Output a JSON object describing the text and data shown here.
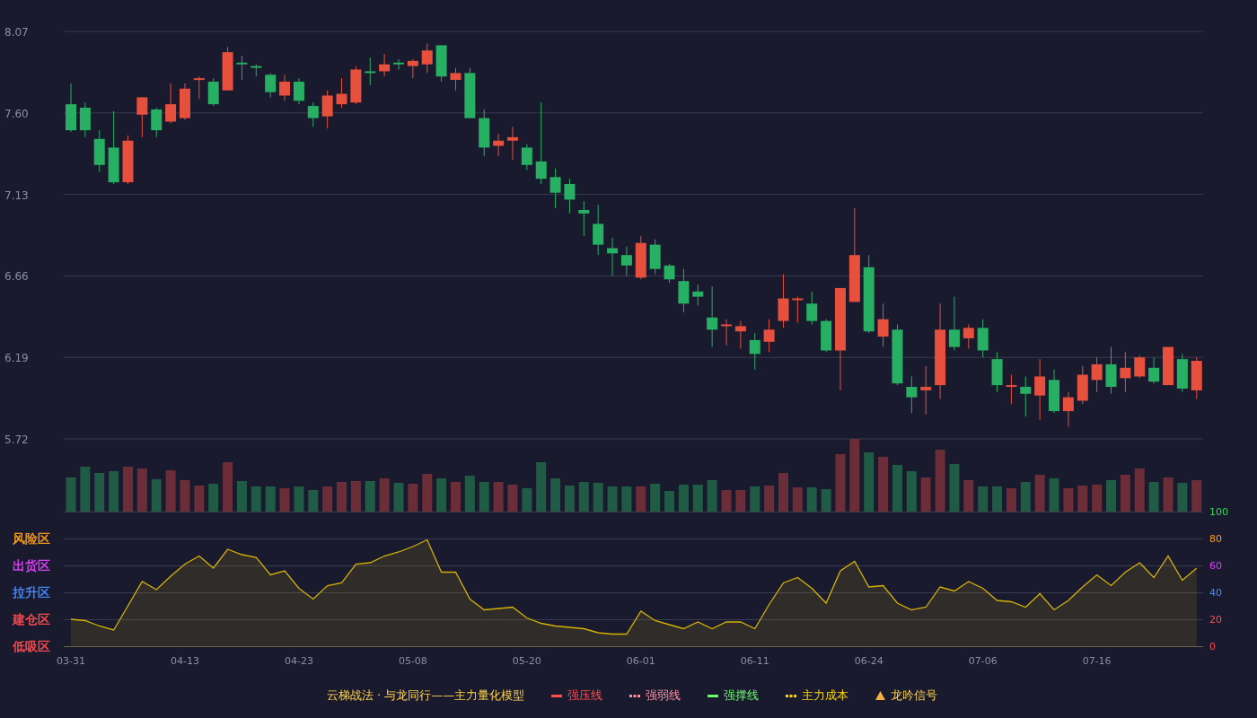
{
  "price_chart": {
    "chart_data": {
      "type": "candlestick",
      "grid": true,
      "ylim": [
        5.72,
        8.07
      ],
      "yticks": [
        {
          "value": 8.07,
          "label": "8.07"
        },
        {
          "value": 7.6,
          "label": "7.60"
        },
        {
          "value": 7.13,
          "label": "7.13"
        },
        {
          "value": 6.66,
          "label": "6.66"
        },
        {
          "value": 6.19,
          "label": "6.19"
        },
        {
          "value": 5.72,
          "label": "5.72"
        }
      ],
      "categories": [
        null,
        null,
        null,
        null,
        null,
        null,
        null,
        null,
        null,
        null,
        null,
        null,
        null,
        null,
        null,
        null,
        null,
        null,
        null,
        null,
        null,
        null,
        null,
        null,
        null,
        null,
        null,
        null,
        null,
        null,
        null,
        null,
        null,
        null,
        null,
        null,
        null,
        null,
        null,
        null,
        null,
        null,
        null,
        null,
        null,
        null,
        null,
        null,
        null,
        null,
        null,
        null,
        null,
        null,
        null,
        null,
        null,
        null,
        null,
        null,
        null,
        null,
        null,
        null,
        null,
        null,
        null,
        null,
        null,
        null,
        null,
        null,
        null,
        null,
        null,
        null,
        null,
        null,
        null,
        null
      ],
      "ohlc": [
        [
          7.65,
          7.77,
          7.49,
          7.5
        ],
        [
          7.63,
          7.66,
          7.46,
          7.5
        ],
        [
          7.45,
          7.5,
          7.26,
          7.3
        ],
        [
          7.4,
          7.61,
          7.19,
          7.2
        ],
        [
          7.2,
          7.47,
          7.19,
          7.44
        ],
        [
          7.59,
          7.69,
          7.46,
          7.69
        ],
        [
          7.62,
          7.63,
          7.46,
          7.5
        ],
        [
          7.55,
          7.77,
          7.54,
          7.65
        ],
        [
          7.57,
          7.77,
          7.56,
          7.74
        ],
        [
          7.79,
          7.81,
          7.68,
          7.8
        ],
        [
          7.78,
          7.8,
          7.64,
          7.65
        ],
        [
          7.73,
          7.98,
          7.73,
          7.95
        ],
        [
          7.89,
          7.93,
          7.79,
          7.88
        ],
        [
          7.87,
          7.88,
          7.81,
          7.86
        ],
        [
          7.82,
          7.83,
          7.69,
          7.72
        ],
        [
          7.7,
          7.82,
          7.67,
          7.78
        ],
        [
          7.78,
          7.8,
          7.65,
          7.67
        ],
        [
          7.64,
          7.66,
          7.52,
          7.57
        ],
        [
          7.58,
          7.73,
          7.51,
          7.7
        ],
        [
          7.65,
          7.8,
          7.63,
          7.71
        ],
        [
          7.66,
          7.87,
          7.65,
          7.85
        ],
        [
          7.84,
          7.92,
          7.76,
          7.83
        ],
        [
          7.84,
          7.94,
          7.81,
          7.88
        ],
        [
          7.89,
          7.91,
          7.85,
          7.88
        ],
        [
          7.87,
          7.91,
          7.8,
          7.9
        ],
        [
          7.88,
          8.0,
          7.83,
          7.96
        ],
        [
          7.99,
          7.99,
          7.78,
          7.81
        ],
        [
          7.79,
          7.86,
          7.73,
          7.83
        ],
        [
          7.83,
          7.86,
          7.57,
          7.57
        ],
        [
          7.57,
          7.62,
          7.35,
          7.4
        ],
        [
          7.41,
          7.48,
          7.35,
          7.44
        ],
        [
          7.44,
          7.52,
          7.33,
          7.46
        ],
        [
          7.4,
          7.42,
          7.27,
          7.3
        ],
        [
          7.32,
          7.66,
          7.19,
          7.22
        ],
        [
          7.23,
          7.28,
          7.05,
          7.14
        ],
        [
          7.19,
          7.22,
          7.02,
          7.1
        ],
        [
          7.04,
          7.09,
          6.89,
          7.02
        ],
        [
          6.96,
          7.07,
          6.78,
          6.84
        ],
        [
          6.82,
          6.88,
          6.66,
          6.79
        ],
        [
          6.78,
          6.83,
          6.66,
          6.72
        ],
        [
          6.65,
          6.89,
          6.64,
          6.85
        ],
        [
          6.84,
          6.87,
          6.67,
          6.7
        ],
        [
          6.72,
          6.73,
          6.62,
          6.64
        ],
        [
          6.63,
          6.7,
          6.45,
          6.5
        ],
        [
          6.57,
          6.61,
          6.49,
          6.54
        ],
        [
          6.42,
          6.6,
          6.25,
          6.35
        ],
        [
          6.37,
          6.41,
          6.26,
          6.38
        ],
        [
          6.34,
          6.4,
          6.24,
          6.37
        ],
        [
          6.29,
          6.33,
          6.12,
          6.21
        ],
        [
          6.28,
          6.41,
          6.22,
          6.35
        ],
        [
          6.4,
          6.67,
          6.36,
          6.53
        ],
        [
          6.52,
          6.54,
          6.39,
          6.53
        ],
        [
          6.5,
          6.57,
          6.38,
          6.4
        ],
        [
          6.4,
          6.41,
          6.22,
          6.23
        ],
        [
          6.23,
          6.59,
          6.0,
          6.59
        ],
        [
          6.51,
          7.05,
          6.51,
          6.78
        ],
        [
          6.71,
          6.78,
          6.33,
          6.34
        ],
        [
          6.31,
          6.5,
          6.25,
          6.41
        ],
        [
          6.35,
          6.38,
          6.03,
          6.04
        ],
        [
          6.02,
          6.08,
          5.87,
          5.96
        ],
        [
          6.0,
          6.14,
          5.86,
          6.02
        ],
        [
          6.03,
          6.5,
          5.95,
          6.35
        ],
        [
          6.35,
          6.54,
          6.23,
          6.25
        ],
        [
          6.3,
          6.38,
          6.24,
          6.36
        ],
        [
          6.36,
          6.41,
          6.19,
          6.23
        ],
        [
          6.18,
          6.22,
          5.99,
          6.03
        ],
        [
          6.02,
          6.09,
          5.92,
          6.03
        ],
        [
          6.02,
          6.08,
          5.85,
          5.98
        ],
        [
          5.97,
          6.18,
          5.83,
          6.08
        ],
        [
          6.06,
          6.12,
          5.87,
          5.88
        ],
        [
          5.88,
          5.99,
          5.79,
          5.96
        ],
        [
          5.94,
          6.14,
          5.92,
          6.09
        ],
        [
          6.06,
          6.19,
          5.99,
          6.15
        ],
        [
          6.15,
          6.25,
          5.98,
          6.02
        ],
        [
          6.07,
          6.22,
          5.99,
          6.13
        ],
        [
          6.08,
          6.2,
          6.07,
          6.19
        ],
        [
          6.13,
          6.19,
          6.04,
          6.05
        ],
        [
          6.03,
          6.25,
          6.03,
          6.25
        ],
        [
          6.18,
          6.21,
          5.99,
          6.01
        ],
        [
          6.0,
          6.19,
          5.95,
          6.17
        ]
      ]
    }
  },
  "indicator_panel": {
    "zones": [
      {
        "label": "风险区",
        "color": "#ff9f1a"
      },
      {
        "label": "出货区",
        "color": "#e040fb"
      },
      {
        "label": "拉升区",
        "color": "#448aff"
      },
      {
        "label": "建仓区",
        "color": "#ff4d4f"
      },
      {
        "label": "低吸区",
        "color": "#ff4d4f"
      }
    ],
    "chart_data": {
      "type": "area",
      "grid": true,
      "ylim": [
        0,
        100
      ],
      "yticks": [
        {
          "value": 100,
          "label": "100"
        },
        {
          "value": 80,
          "label": "80"
        },
        {
          "value": 60,
          "label": "60"
        },
        {
          "value": 40,
          "label": "40"
        },
        {
          "value": 20,
          "label": "20"
        },
        {
          "value": 0,
          "label": "0"
        }
      ],
      "categories": [
        "03-31",
        null,
        null,
        null,
        null,
        null,
        null,
        null,
        "04-13",
        null,
        null,
        null,
        null,
        null,
        null,
        null,
        "04-23",
        null,
        null,
        null,
        null,
        null,
        null,
        null,
        "05-08",
        null,
        null,
        null,
        null,
        null,
        null,
        null,
        "05-20",
        null,
        null,
        null,
        null,
        null,
        null,
        null,
        "06-01",
        null,
        null,
        null,
        null,
        null,
        null,
        null,
        "06-11",
        null,
        null,
        null,
        null,
        null,
        null,
        null,
        "06-24",
        null,
        null,
        null,
        null,
        null,
        null,
        null,
        "07-06",
        null,
        null,
        null,
        null,
        null,
        null,
        null,
        "07-16",
        null,
        null,
        null,
        null,
        null,
        null,
        null
      ],
      "series": [
        {
          "color": "#d4b106",
          "values": [
            20,
            19,
            15,
            12,
            30,
            48,
            42,
            52,
            61,
            67,
            58,
            72,
            68,
            66,
            53,
            56,
            43,
            35,
            45,
            47,
            61,
            62,
            67,
            70,
            74,
            79,
            55,
            55,
            35,
            27,
            28,
            29,
            21,
            17,
            15,
            14,
            13,
            10,
            9,
            9,
            26,
            19,
            16,
            13,
            18,
            13,
            18,
            18,
            13,
            31,
            47,
            51,
            43,
            32,
            56,
            63,
            44,
            45,
            32,
            27,
            29,
            44,
            41,
            48,
            43,
            34,
            33,
            29,
            39,
            27,
            34,
            44,
            53,
            45,
            55,
            62,
            51,
            67,
            49,
            58
          ]
        }
      ]
    }
  },
  "legend": {
    "title": "云梯战法 · 与龙同行——主力量化模型",
    "items": [
      {
        "label": "强压线",
        "kind": "solid",
        "color": "#ff4d4f"
      },
      {
        "label": "强弱线",
        "kind": "dashed",
        "color": "#ff8fa3"
      },
      {
        "label": "强撑线",
        "kind": "solid",
        "color": "#66ff66"
      },
      {
        "label": "主力成本",
        "kind": "dashed",
        "color": "#ffd700"
      },
      {
        "label": "龙吟信号",
        "kind": "triangle",
        "color": "#f5b041"
      }
    ]
  }
}
